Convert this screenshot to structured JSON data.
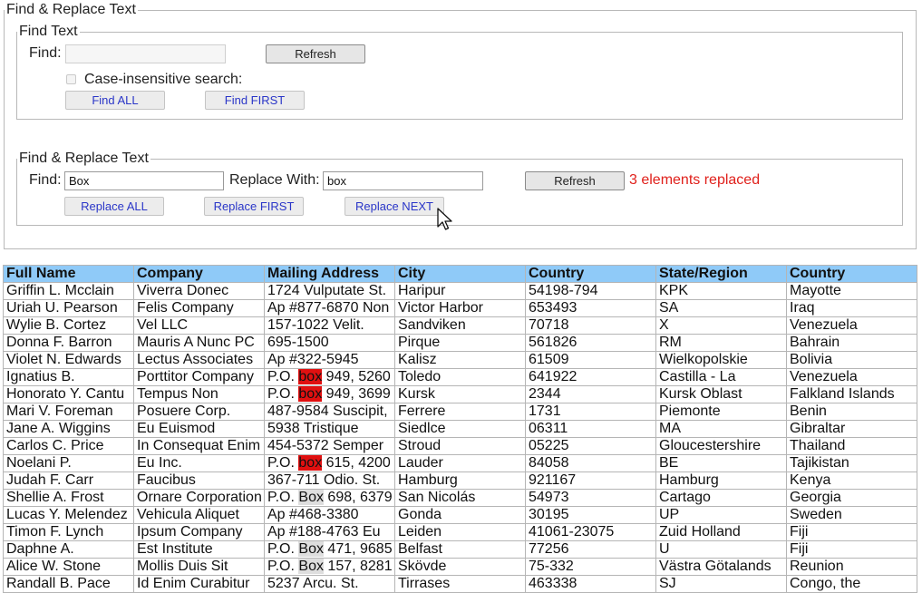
{
  "outer_legend": "Find & Replace Text",
  "find_section": {
    "legend": "Find Text",
    "find_label": "Find:",
    "find_value": "",
    "refresh_label": "Refresh",
    "case_label": "Case-insensitive search:",
    "find_all_label": "Find ALL",
    "find_first_label": "Find FIRST"
  },
  "replace_section": {
    "legend": "Find & Replace Text",
    "find_label": "Find:",
    "find_value": "Box",
    "replace_label": "Replace With:",
    "replace_value": "box",
    "refresh_label": "Refresh",
    "status": "3 elements replaced",
    "status_color": "#e0201b",
    "replace_all_label": "Replace ALL",
    "replace_first_label": "Replace FIRST",
    "replace_next_label": "Replace NEXT"
  },
  "table": {
    "header_color": "#8fcaf8",
    "highlight_replaced_color": "#e01010",
    "highlight_match_color": "#dedede",
    "columns": [
      "Full Name",
      "Company",
      "Mailing Address",
      "City",
      "Country",
      "State/Region",
      "Country"
    ],
    "rows": [
      {
        "name": "Griffin L. Mcclain",
        "company": "Viverra Donec",
        "addr_pre": "1724 Vulputate St.",
        "hl": "",
        "hl_type": "",
        "addr_post": "",
        "city": "Haripur",
        "country": "54198-794",
        "state": "KPK",
        "country2": "Mayotte"
      },
      {
        "name": "Uriah U. Pearson",
        "company": "Felis Company",
        "addr_pre": "Ap #877-6870 Non",
        "hl": "",
        "hl_type": "",
        "addr_post": "",
        "city": "Victor Harbor",
        "country": "653493",
        "state": "SA",
        "country2": "Iraq"
      },
      {
        "name": "Wylie B. Cortez",
        "company": "Vel LLC",
        "addr_pre": "157-1022 Velit.",
        "hl": "",
        "hl_type": "",
        "addr_post": "",
        "city": "Sandviken",
        "country": "70718",
        "state": "X",
        "country2": "Venezuela"
      },
      {
        "name": "Donna F. Barron",
        "company": "Mauris A Nunc PC",
        "addr_pre": "695-1500",
        "hl": "",
        "hl_type": "",
        "addr_post": "",
        "city": "Pirque",
        "country": "561826",
        "state": "RM",
        "country2": "Bahrain"
      },
      {
        "name": "Violet N. Edwards",
        "company": "Lectus Associates",
        "addr_pre": "Ap #322-5945",
        "hl": "",
        "hl_type": "",
        "addr_post": "",
        "city": "Kalisz",
        "country": "61509",
        "state": "Wielkopolskie",
        "country2": "Bolivia"
      },
      {
        "name": "Ignatius B.",
        "company": "Porttitor Company",
        "addr_pre": "P.O. ",
        "hl": "box",
        "hl_type": "red",
        "addr_post": " 949, 5260",
        "city": "Toledo",
        "country": "641922",
        "state": "Castilla - La",
        "country2": "Venezuela"
      },
      {
        "name": "Honorato Y. Cantu",
        "company": "Tempus Non",
        "addr_pre": "P.O. ",
        "hl": "box",
        "hl_type": "red",
        "addr_post": " 949, 3699",
        "city": "Kursk",
        "country": "2344",
        "state": "Kursk Oblast",
        "country2": "Falkland Islands"
      },
      {
        "name": "Mari V. Foreman",
        "company": "Posuere Corp.",
        "addr_pre": "487-9584 Suscipit,",
        "hl": "",
        "hl_type": "",
        "addr_post": "",
        "city": "Ferrere",
        "country": "1731",
        "state": "Piemonte",
        "country2": "Benin"
      },
      {
        "name": "Jane A. Wiggins",
        "company": "Eu Euismod",
        "addr_pre": "5938 Tristique",
        "hl": "",
        "hl_type": "",
        "addr_post": "",
        "city": "Siedlce",
        "country": "06311",
        "state": "MA",
        "country2": "Gibraltar"
      },
      {
        "name": "Carlos C. Price",
        "company": "In Consequat Enim",
        "addr_pre": "454-5372 Semper",
        "hl": "",
        "hl_type": "",
        "addr_post": "",
        "city": "Stroud",
        "country": "05225",
        "state": "Gloucestershire",
        "country2": "Thailand"
      },
      {
        "name": "Noelani P.",
        "company": "Eu Inc.",
        "addr_pre": "P.O. ",
        "hl": "box",
        "hl_type": "red",
        "addr_post": " 615, 4200",
        "city": "Lauder",
        "country": "84058",
        "state": "BE",
        "country2": "Tajikistan"
      },
      {
        "name": "Judah F. Carr",
        "company": "Faucibus",
        "addr_pre": "367-711 Odio. St.",
        "hl": "",
        "hl_type": "",
        "addr_post": "",
        "city": "Hamburg",
        "country": "921167",
        "state": "Hamburg",
        "country2": "Kenya"
      },
      {
        "name": "Shellie A. Frost",
        "company": "Ornare Corporation",
        "addr_pre": "P.O. ",
        "hl": "Box",
        "hl_type": "gray",
        "addr_post": " 698, 6379",
        "city": "San Nicolás",
        "country": "54973",
        "state": "Cartago",
        "country2": "Georgia"
      },
      {
        "name": "Lucas Y. Melendez",
        "company": "Vehicula Aliquet",
        "addr_pre": "Ap #468-3380",
        "hl": "",
        "hl_type": "",
        "addr_post": "",
        "city": "Gonda",
        "country": "30195",
        "state": "UP",
        "country2": "Sweden"
      },
      {
        "name": "Timon F. Lynch",
        "company": "Ipsum Company",
        "addr_pre": "Ap #188-4763 Eu",
        "hl": "",
        "hl_type": "",
        "addr_post": "",
        "city": "Leiden",
        "country": "41061-23075",
        "state": "Zuid Holland",
        "country2": "Fiji"
      },
      {
        "name": "Daphne A.",
        "company": "Est Institute",
        "addr_pre": "P.O. ",
        "hl": "Box",
        "hl_type": "gray",
        "addr_post": " 471, 9685",
        "city": "Belfast",
        "country": "77256",
        "state": "U",
        "country2": "Fiji"
      },
      {
        "name": "Alice W. Stone",
        "company": "Mollis Duis Sit",
        "addr_pre": "P.O. ",
        "hl": "Box",
        "hl_type": "gray",
        "addr_post": " 157, 8281",
        "city": "Skövde",
        "country": "75-332",
        "state": "Västra Götalands",
        "country2": "Reunion"
      },
      {
        "name": "Randall B. Pace",
        "company": "Id Enim Curabitur",
        "addr_pre": "5237 Arcu. St.",
        "hl": "",
        "hl_type": "",
        "addr_post": "",
        "city": "Tirrases",
        "country": "463338",
        "state": "SJ",
        "country2": "Congo, the"
      }
    ]
  }
}
